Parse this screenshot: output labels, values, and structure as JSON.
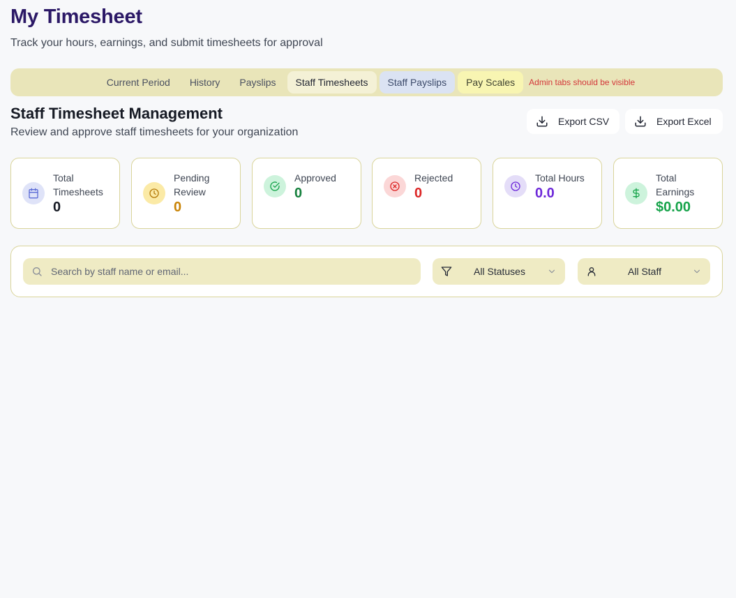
{
  "header": {
    "title": "My Timesheet",
    "subtitle": "Track your hours, earnings, and submit timesheets for approval"
  },
  "tabs": [
    {
      "label": "Current Period",
      "active": false
    },
    {
      "label": "History",
      "active": false
    },
    {
      "label": "Payslips",
      "active": false
    },
    {
      "label": "Staff Timesheets",
      "active": true
    },
    {
      "label": "Staff Payslips",
      "active": false
    },
    {
      "label": "Pay Scales",
      "active": false
    }
  ],
  "admin_note": "Admin tabs should be visible",
  "section": {
    "title": "Staff Timesheet Management",
    "subtitle": "Review and approve staff timesheets for your organization"
  },
  "actions": {
    "export_csv": "Export CSV",
    "export_excel": "Export Excel"
  },
  "stats": [
    {
      "label": "Total Timesheets",
      "value": "0",
      "icon": "calendar-icon",
      "color": "#161a24",
      "icon_color": "#5b6bd6",
      "icon_bg": "#dfe3f8"
    },
    {
      "label": "Pending Review",
      "value": "0",
      "icon": "clock-icon",
      "color": "#c98306",
      "icon_color": "#b47a0a",
      "icon_bg": "#fbeaa6"
    },
    {
      "label": "Approved",
      "value": "0",
      "icon": "check-circle-icon",
      "color": "#15803d",
      "icon_color": "#16a34a",
      "icon_bg": "#cdf3dc"
    },
    {
      "label": "Rejected",
      "value": "0",
      "icon": "x-circle-icon",
      "color": "#dc2626",
      "icon_color": "#dc2626",
      "icon_bg": "#fbd7d7"
    },
    {
      "label": "Total Hours",
      "value": "0.0",
      "icon": "clock-icon",
      "color": "#6d28d9",
      "icon_color": "#6d28d9",
      "icon_bg": "#e4ddf8"
    },
    {
      "label": "Total Earnings",
      "value": "$0.00",
      "icon": "dollar-icon",
      "color": "#16a34a",
      "icon_color": "#16a34a",
      "icon_bg": "#cdf3dc"
    }
  ],
  "filters": {
    "search_placeholder": "Search by staff name or email...",
    "search_value": "",
    "status": "All Statuses",
    "staff": "All Staff"
  }
}
